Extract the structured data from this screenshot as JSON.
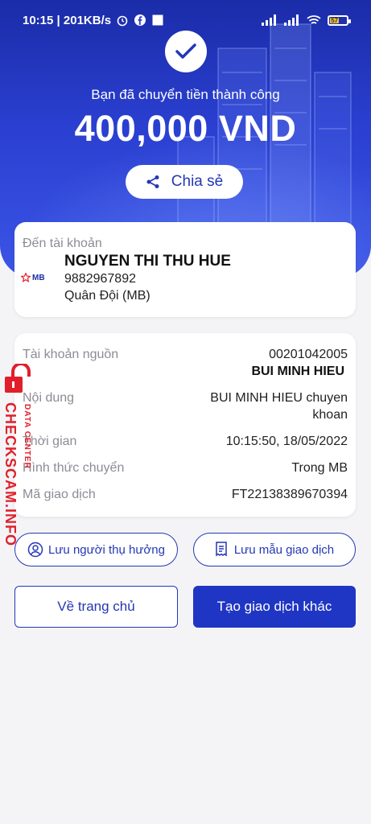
{
  "statusbar": {
    "time_net": "10:15 | 201KB/s",
    "battery_level": "57"
  },
  "hero": {
    "success_text": "Bạn đã chuyển tiền thành công",
    "amount": "400,000 VND",
    "share_label": "Chia sẻ"
  },
  "recipient": {
    "label": "Đến tài khoản",
    "bank_logo_text": "MB",
    "name": "NGUYEN THI THU HUE",
    "account": "9882967892",
    "bank": "Quân Đội (MB)"
  },
  "details": {
    "source_label": "Tài khoản nguồn",
    "source_account": "00201042005",
    "source_name": "BUI MINH HIEU",
    "content_label": "Nội dung",
    "content_line1": "BUI MINH HIEU chuyen",
    "content_line2": "khoan",
    "time_label": "Thời gian",
    "time_value": "10:15:50, 18/05/2022",
    "method_label": "Hình thức chuyển",
    "method_value": "Trong MB",
    "txn_label": "Mã giao dịch",
    "txn_value": "FT22138389670394"
  },
  "watermark": {
    "main": "CHECKSCAM.INFO",
    "sub": "DATA CENTER"
  },
  "actions": {
    "save_recipient": "Lưu người thụ hưởng",
    "save_template": "Lưu mẫu giao dịch",
    "home": "Về trang chủ",
    "new_transaction": "Tạo giao dịch khác"
  },
  "colors": {
    "brand": "#1f36c4",
    "watermark": "#e11f2a"
  }
}
